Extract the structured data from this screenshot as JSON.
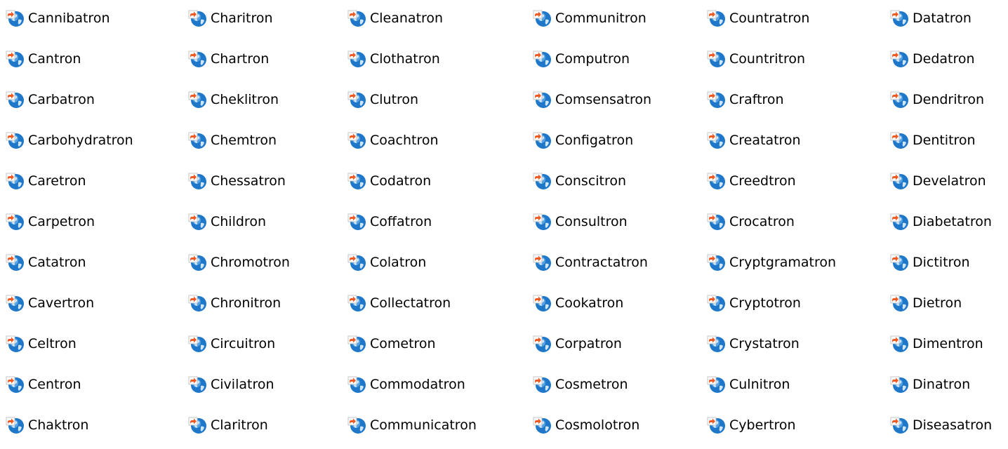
{
  "icon": {
    "name": "internet-shortcut-globe-icon",
    "globe_color": "#1e77c9",
    "globe_highlight": "#6fb5ec",
    "land_color": "#cfe6f7",
    "arrow_color": "#f15a22"
  },
  "columns": [
    {
      "items": [
        {
          "label": "Cannibatron"
        },
        {
          "label": "Cantron"
        },
        {
          "label": "Carbatron"
        },
        {
          "label": "Carbohydratron"
        },
        {
          "label": "Caretron"
        },
        {
          "label": "Carpetron"
        },
        {
          "label": "Catatron"
        },
        {
          "label": "Cavertron"
        },
        {
          "label": "Celtron"
        },
        {
          "label": "Centron"
        },
        {
          "label": "Chaktron"
        }
      ]
    },
    {
      "items": [
        {
          "label": "Charitron"
        },
        {
          "label": "Chartron"
        },
        {
          "label": "Cheklitron"
        },
        {
          "label": "Chemtron"
        },
        {
          "label": "Chessatron"
        },
        {
          "label": "Childron"
        },
        {
          "label": "Chromotron"
        },
        {
          "label": "Chronitron"
        },
        {
          "label": "Circuitron"
        },
        {
          "label": "Civilatron"
        },
        {
          "label": "Claritron"
        }
      ]
    },
    {
      "items": [
        {
          "label": "Cleanatron"
        },
        {
          "label": "Clothatron"
        },
        {
          "label": "Clutron"
        },
        {
          "label": "Coachtron"
        },
        {
          "label": "Codatron"
        },
        {
          "label": "Coffatron"
        },
        {
          "label": "Colatron"
        },
        {
          "label": "Collectatron"
        },
        {
          "label": "Cometron"
        },
        {
          "label": "Commodatron"
        },
        {
          "label": "Communicatron"
        }
      ]
    },
    {
      "items": [
        {
          "label": "Communitron"
        },
        {
          "label": "Computron"
        },
        {
          "label": "Comsensatron"
        },
        {
          "label": "Configatron"
        },
        {
          "label": "Conscitron"
        },
        {
          "label": "Consultron"
        },
        {
          "label": "Contractatron"
        },
        {
          "label": "Cookatron"
        },
        {
          "label": "Corpatron"
        },
        {
          "label": "Cosmetron"
        },
        {
          "label": "Cosmolotron"
        }
      ]
    },
    {
      "items": [
        {
          "label": "Countratron"
        },
        {
          "label": "Countritron"
        },
        {
          "label": "Craftron"
        },
        {
          "label": "Creatatron"
        },
        {
          "label": "Creedtron"
        },
        {
          "label": "Crocatron"
        },
        {
          "label": "Cryptgramatron"
        },
        {
          "label": "Cryptotron"
        },
        {
          "label": "Crystatron"
        },
        {
          "label": "Culnitron"
        },
        {
          "label": "Cybertron"
        }
      ]
    },
    {
      "items": [
        {
          "label": "Datatron"
        },
        {
          "label": "Dedatron"
        },
        {
          "label": "Dendritron"
        },
        {
          "label": "Dentitron"
        },
        {
          "label": "Develatron"
        },
        {
          "label": "Diabetatron"
        },
        {
          "label": "Dictitron"
        },
        {
          "label": "Dietron"
        },
        {
          "label": "Dimentron"
        },
        {
          "label": "Dinatron"
        },
        {
          "label": "Diseasatron"
        }
      ]
    }
  ]
}
